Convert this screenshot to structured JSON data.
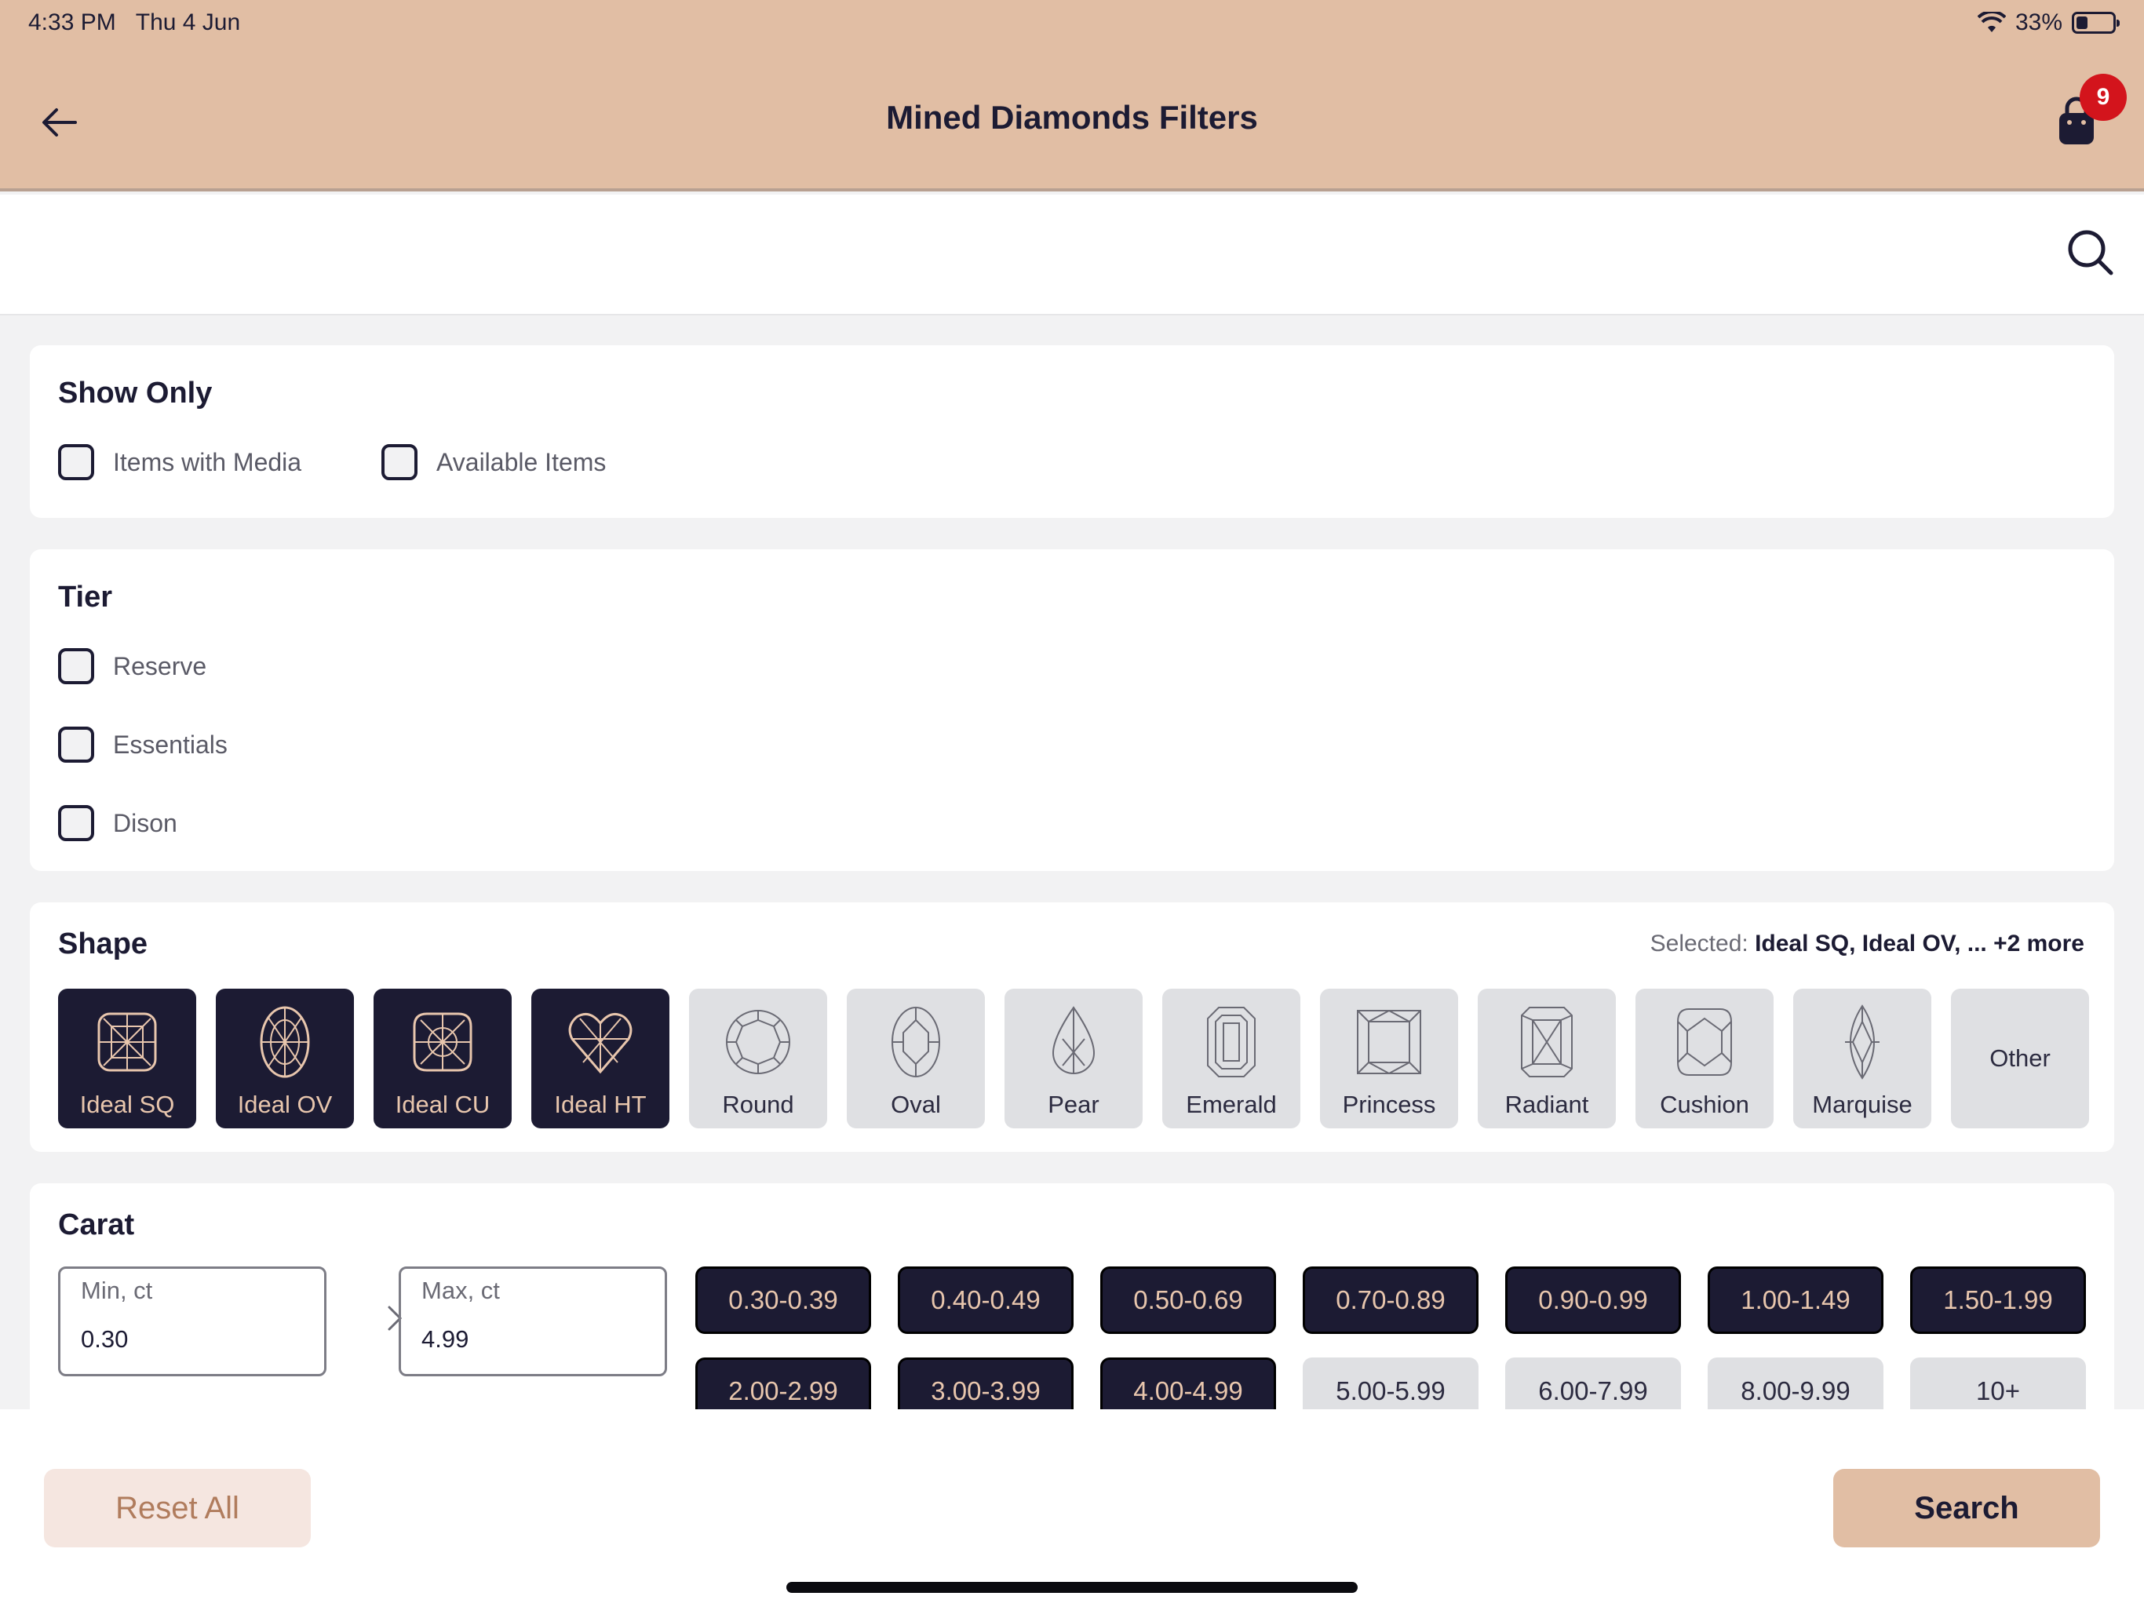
{
  "status_bar": {
    "time": "4:33 PM",
    "date": "Thu 4 Jun",
    "battery": "33%"
  },
  "header": {
    "title": "Mined Diamonds Filters",
    "cart_count": "9"
  },
  "show_only": {
    "title": "Show Only",
    "options": [
      "Items with Media",
      "Available Items"
    ]
  },
  "tier": {
    "title": "Tier",
    "options": [
      "Reserve",
      "Essentials",
      "Dison"
    ]
  },
  "shape": {
    "title": "Shape",
    "selected_label": "Selected:",
    "selected_values": "Ideal SQ, Ideal OV, ...",
    "selected_more": "+2 more",
    "items": [
      {
        "label": "Ideal SQ",
        "selected": true,
        "icon": "ideal-square-diamond-icon"
      },
      {
        "label": "Ideal OV",
        "selected": true,
        "icon": "ideal-oval-diamond-icon"
      },
      {
        "label": "Ideal CU",
        "selected": true,
        "icon": "ideal-cushion-diamond-icon"
      },
      {
        "label": "Ideal HT",
        "selected": true,
        "icon": "ideal-heart-diamond-icon"
      },
      {
        "label": "Round",
        "selected": false,
        "icon": "round-diamond-icon"
      },
      {
        "label": "Oval",
        "selected": false,
        "icon": "oval-diamond-icon"
      },
      {
        "label": "Pear",
        "selected": false,
        "icon": "pear-diamond-icon"
      },
      {
        "label": "Emerald",
        "selected": false,
        "icon": "emerald-diamond-icon"
      },
      {
        "label": "Princess",
        "selected": false,
        "icon": "princess-diamond-icon"
      },
      {
        "label": "Radiant",
        "selected": false,
        "icon": "radiant-diamond-icon"
      },
      {
        "label": "Cushion",
        "selected": false,
        "icon": "cushion-diamond-icon"
      },
      {
        "label": "Marquise",
        "selected": false,
        "icon": "marquise-diamond-icon"
      },
      {
        "label": "Other",
        "selected": false,
        "icon": ""
      }
    ]
  },
  "carat": {
    "title": "Carat",
    "min_label": "Min, ct",
    "min_value": "0.30",
    "max_label": "Max, ct",
    "max_value": "4.99",
    "ranges": [
      {
        "label": "0.30-0.39",
        "selected": true
      },
      {
        "label": "0.40-0.49",
        "selected": true
      },
      {
        "label": "0.50-0.69",
        "selected": true
      },
      {
        "label": "0.70-0.89",
        "selected": true
      },
      {
        "label": "0.90-0.99",
        "selected": true
      },
      {
        "label": "1.00-1.49",
        "selected": true
      },
      {
        "label": "1.50-1.99",
        "selected": true
      },
      {
        "label": "2.00-2.99",
        "selected": true
      },
      {
        "label": "3.00-3.99",
        "selected": true
      },
      {
        "label": "4.00-4.99",
        "selected": true
      },
      {
        "label": "5.00-5.99",
        "selected": false
      },
      {
        "label": "6.00-7.99",
        "selected": false
      },
      {
        "label": "8.00-9.99",
        "selected": false
      },
      {
        "label": "10+",
        "selected": false
      }
    ]
  },
  "footer": {
    "reset_label": "Reset All",
    "search_label": "Search"
  },
  "colors": {
    "header_bg": "#e1bea4",
    "dark": "#1c1b33",
    "accent_text": "#e8c6ad",
    "badge": "#d3141c"
  }
}
